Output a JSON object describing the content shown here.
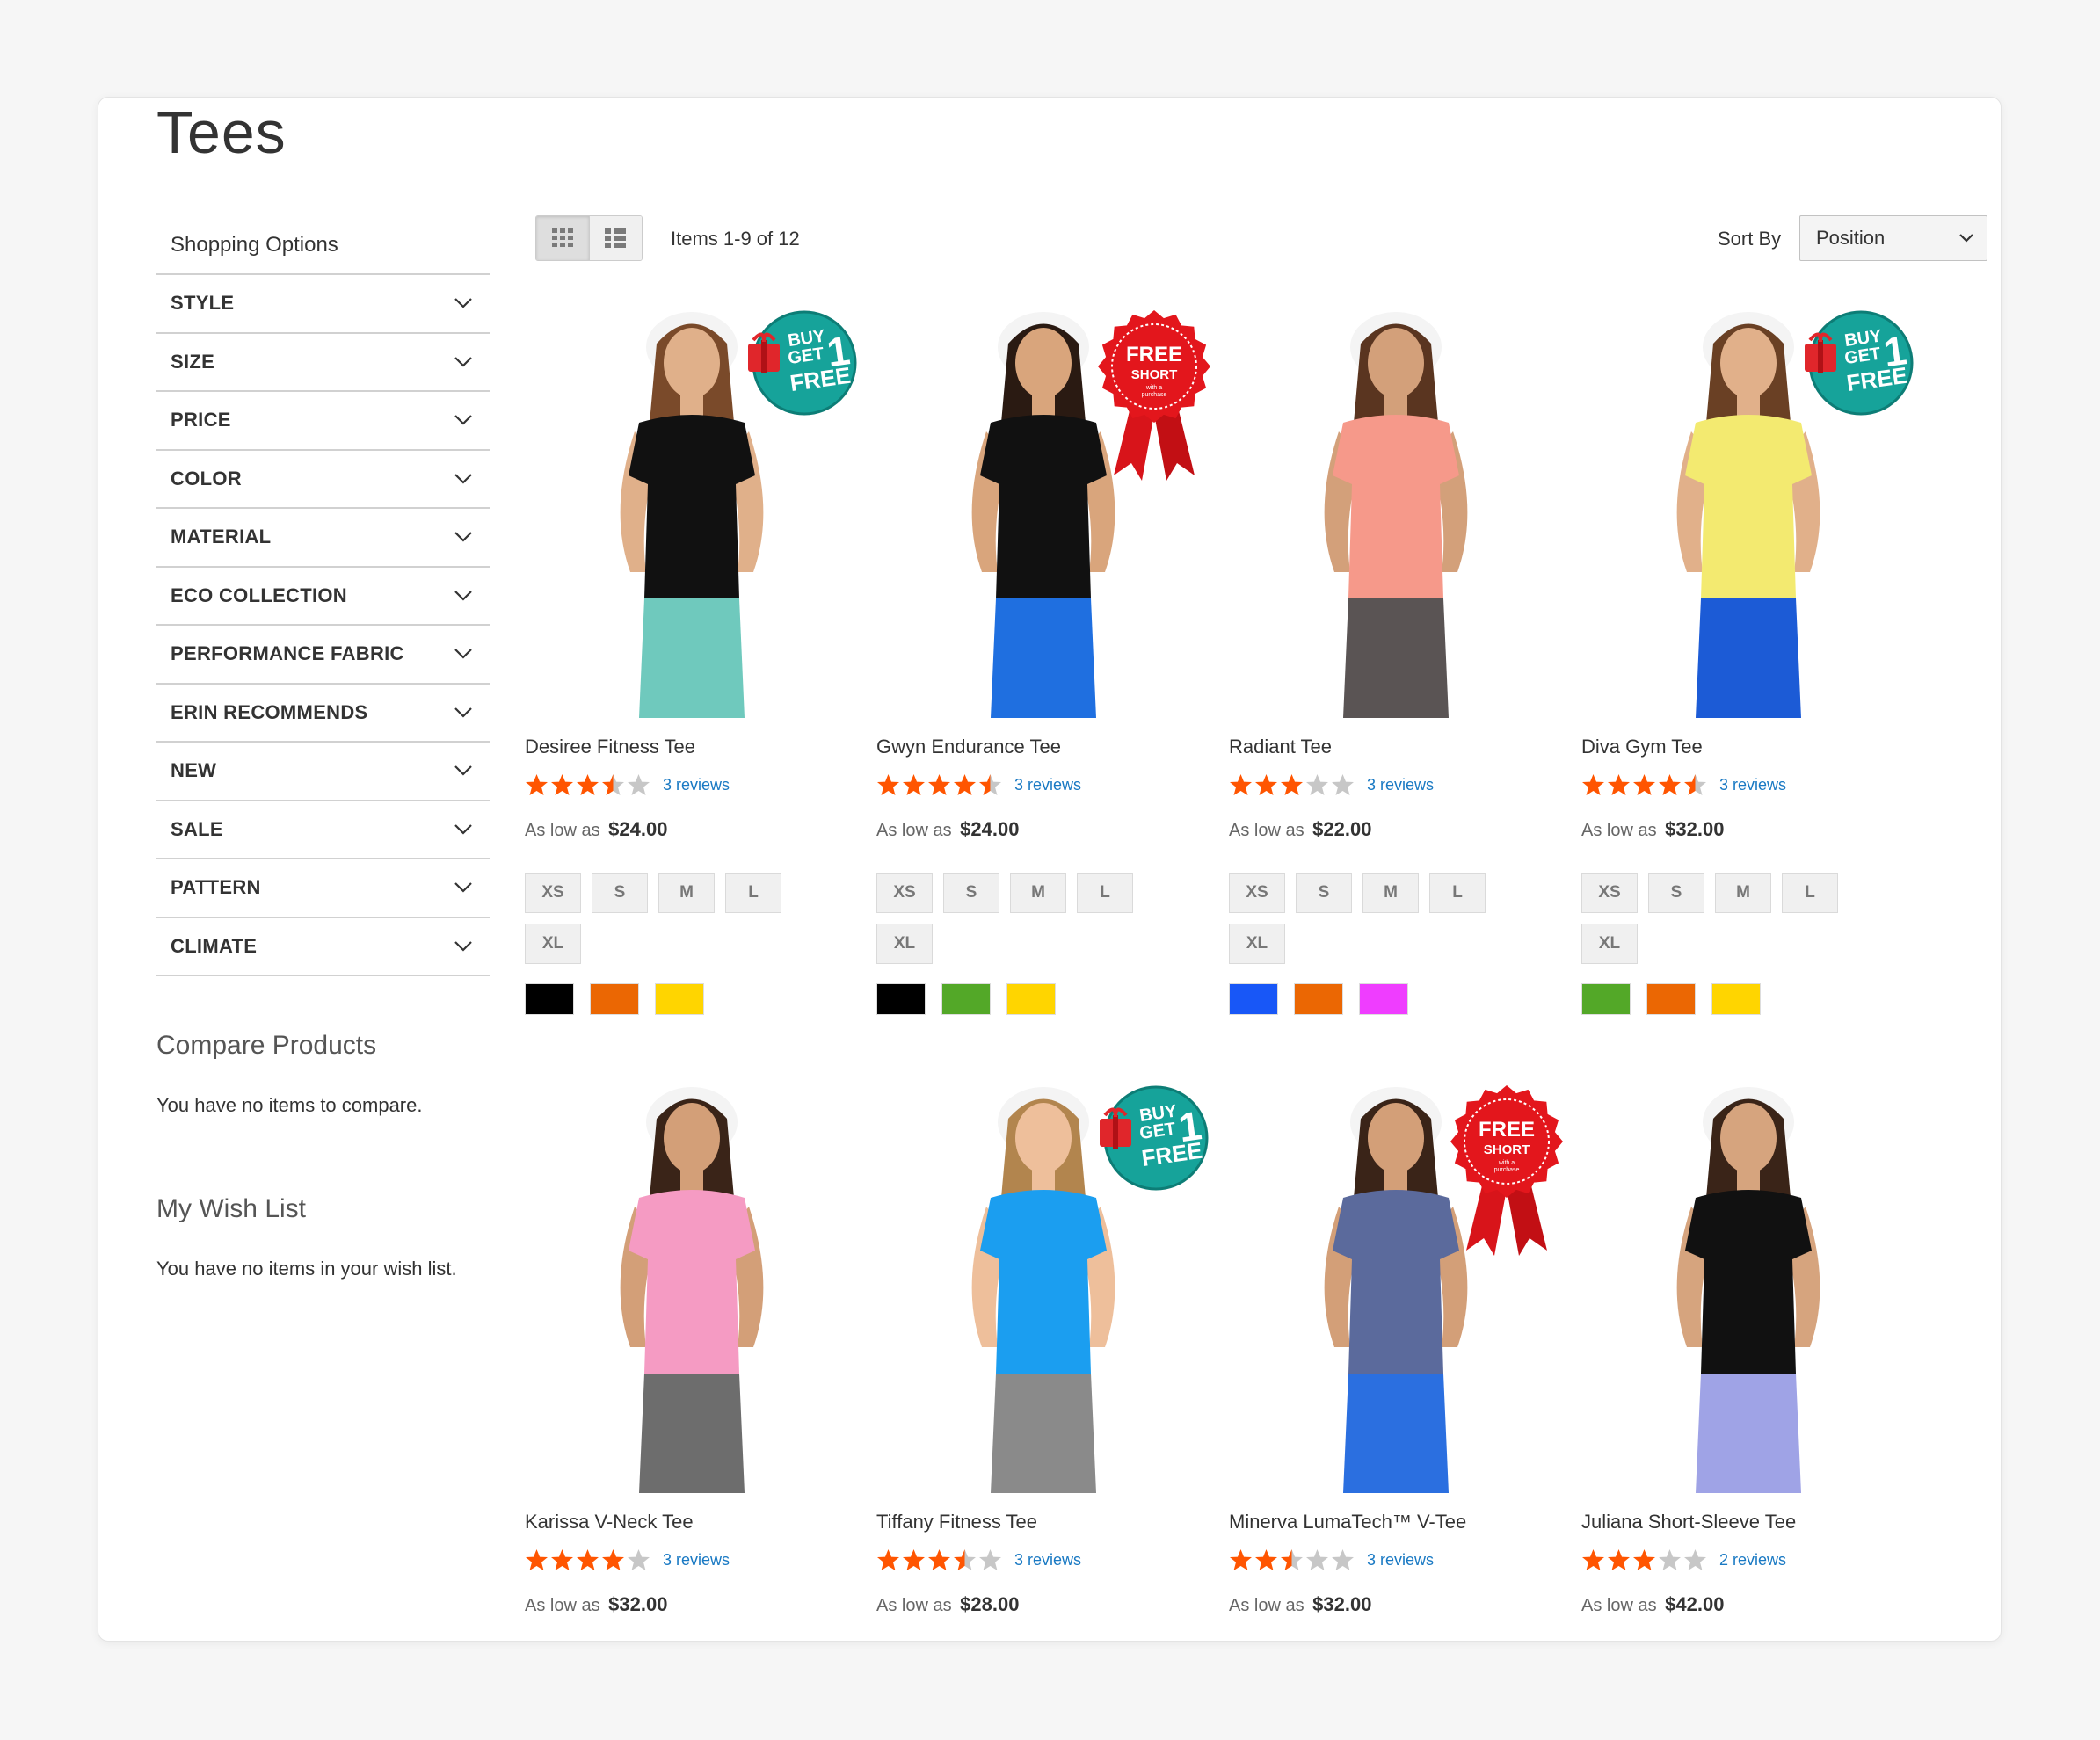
{
  "page": {
    "title": "Tees"
  },
  "sidebar": {
    "heading": "Shopping Options",
    "filters": [
      "STYLE",
      "SIZE",
      "PRICE",
      "COLOR",
      "MATERIAL",
      "ECO COLLECTION",
      "PERFORMANCE FABRIC",
      "ERIN RECOMMENDS",
      "NEW",
      "SALE",
      "PATTERN",
      "CLIMATE"
    ],
    "compare": {
      "title": "Compare Products",
      "text": "You have no items to compare."
    },
    "wishlist": {
      "title": "My Wish List",
      "text": "You have no items in your wish list."
    }
  },
  "toolbar": {
    "items_count": "Items 1-9 of 12",
    "sort_label": "Sort By",
    "sort_value": "Position"
  },
  "price_prefix": "As low as",
  "ribbon_text": {
    "buy1": [
      "BUY",
      "GET",
      "1",
      "FREE"
    ],
    "free_short": [
      "FREE",
      "SHORT",
      "with a",
      "purchase"
    ]
  },
  "products": [
    {
      "name": "Desiree Fitness Tee",
      "rating": 3.5,
      "reviews": "3 reviews",
      "price": "$24.00",
      "sizes": [
        "XS",
        "S",
        "M",
        "L",
        "XL"
      ],
      "colors": [
        "#000000",
        "#eb6703",
        "#ffd500"
      ],
      "badge": "buy1",
      "shirt": "#111111",
      "bottom": "#6fc9bd",
      "skin": "#e0b08a",
      "hair": "#7a4a2a"
    },
    {
      "name": "Gwyn Endurance Tee",
      "rating": 4.5,
      "reviews": "3 reviews",
      "price": "$24.00",
      "sizes": [
        "XS",
        "S",
        "M",
        "L",
        "XL"
      ],
      "colors": [
        "#000000",
        "#53a828",
        "#ffd500"
      ],
      "badge": "free_short",
      "shirt": "#111111",
      "bottom": "#1f6fe0",
      "skin": "#d9a57c",
      "hair": "#2a1a12"
    },
    {
      "name": "Radiant Tee",
      "rating": 3,
      "reviews": "3 reviews",
      "price": "$22.00",
      "sizes": [
        "XS",
        "S",
        "M",
        "L",
        "XL"
      ],
      "colors": [
        "#1857f7",
        "#eb6703",
        "#ef3dff"
      ],
      "badge": null,
      "shirt": "#f6998a",
      "bottom": "#5a5454",
      "skin": "#d3a07a",
      "hair": "#5a3520"
    },
    {
      "name": "Diva Gym Tee",
      "rating": 4.5,
      "reviews": "3 reviews",
      "price": "$32.00",
      "sizes": [
        "XS",
        "S",
        "M",
        "L",
        "XL"
      ],
      "colors": [
        "#53a828",
        "#eb6703",
        "#ffd500"
      ],
      "badge": "buy1",
      "shirt": "#f3ea70",
      "bottom": "#1c5bd6",
      "skin": "#e1b08a",
      "hair": "#6a4024"
    },
    {
      "name": "Karissa V-Neck Tee",
      "rating": 4,
      "reviews": "3 reviews",
      "price": "$32.00",
      "sizes": [],
      "colors": [],
      "badge": null,
      "shirt": "#f59bc3",
      "bottom": "#6d6d6d",
      "skin": "#d39f78",
      "hair": "#3a2418"
    },
    {
      "name": "Tiffany Fitness Tee",
      "rating": 3.5,
      "reviews": "3 reviews",
      "price": "$28.00",
      "sizes": [],
      "colors": [],
      "badge": "buy1",
      "shirt": "#1b9ef0",
      "bottom": "#8a8a8a",
      "skin": "#eebf9b",
      "hair": "#b2854e"
    },
    {
      "name": "Minerva LumaTech™ V-Tee",
      "rating": 2.5,
      "reviews": "3 reviews",
      "price": "$32.00",
      "sizes": [],
      "colors": [],
      "badge": "free_short",
      "shirt": "#5b6a9c",
      "bottom": "#2b6fe0",
      "skin": "#d39f78",
      "hair": "#3a2418"
    },
    {
      "name": "Juliana Short-Sleeve Tee",
      "rating": 3,
      "reviews": "2 reviews",
      "price": "$42.00",
      "sizes": [],
      "colors": [],
      "badge": null,
      "shirt": "#111111",
      "bottom": "#9fa3e6",
      "skin": "#d6a47e",
      "hair": "#3a2418"
    }
  ]
}
